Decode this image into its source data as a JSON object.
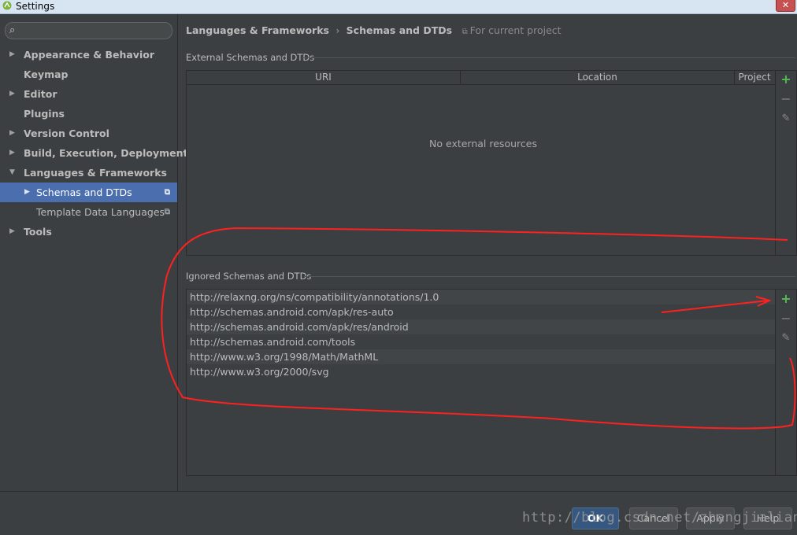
{
  "window": {
    "title": "Settings",
    "close": "✕"
  },
  "sidebar": {
    "search_placeholder": "",
    "items": [
      {
        "label": "Appearance & Behavior",
        "arrow": "▶"
      },
      {
        "label": "Keymap",
        "arrow": ""
      },
      {
        "label": "Editor",
        "arrow": "▶"
      },
      {
        "label": "Plugins",
        "arrow": ""
      },
      {
        "label": "Version Control",
        "arrow": "▶"
      },
      {
        "label": "Build, Execution, Deployment",
        "arrow": "▶"
      },
      {
        "label": "Languages & Frameworks",
        "arrow": "▼"
      },
      {
        "label": "Schemas and DTDs",
        "arrow": "▶",
        "selected": true
      },
      {
        "label": "Template Data Languages",
        "arrow": ""
      },
      {
        "label": "Tools",
        "arrow": "▶"
      }
    ]
  },
  "header": {
    "crumb_parent": "Languages & Frameworks",
    "crumb_sep": "›",
    "crumb_current": "Schemas and DTDs",
    "scope": "For current project"
  },
  "external": {
    "title": "External Schemas and DTDs",
    "columns": [
      "URI",
      "Location",
      "Project"
    ],
    "empty_text": "No external resources"
  },
  "ignored": {
    "title": "Ignored Schemas and DTDs",
    "items": [
      "http://relaxng.org/ns/compatibility/annotations/1.0",
      "http://schemas.android.com/apk/res-auto",
      "http://schemas.android.com/apk/res/android",
      "http://schemas.android.com/tools",
      "http://www.w3.org/1998/Math/MathML",
      "http://www.w3.org/2000/svg"
    ]
  },
  "toolbar": {
    "add": "+",
    "remove": "−",
    "edit": "✎"
  },
  "footer": {
    "ok": "OK",
    "cancel": "Cancel",
    "apply": "Apply",
    "help": "Help"
  },
  "watermark": "http://blog.csdn.net/zhangjialiang",
  "colors": {
    "accent": "#4b6eaf",
    "annotation": "#ff2020",
    "add": "#4fbf4f"
  },
  "icons": [
    "android-studio-icon",
    "search-icon",
    "project-scope-icon",
    "add-icon",
    "remove-icon",
    "edit-icon"
  ]
}
